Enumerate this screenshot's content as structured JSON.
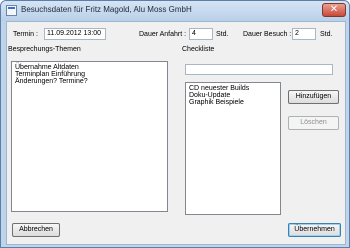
{
  "window": {
    "title": "Besuchsdaten für Fritz Magold, Alu Moss GmbH",
    "close_glyph": "✕"
  },
  "termin": {
    "label": "Termin :",
    "value": "11.09.2012 13:00"
  },
  "dauer_anfahrt": {
    "label": "Dauer Anfahrt :",
    "value": "4",
    "unit": "Std."
  },
  "dauer_besuch": {
    "label": "Dauer Besuch :",
    "value": "2",
    "unit": "Std."
  },
  "themen": {
    "label": "Besprechungs-Themen",
    "items": [
      "Übernahme Altdaten",
      "Terminplan Einführung",
      "Änderungen? Termine?"
    ]
  },
  "checkliste": {
    "label": "Checkliste",
    "input_value": "",
    "items": [
      "CD neuester Builds",
      "Doku-Update",
      "Graphik Beispiele"
    ],
    "add_label": "Hinzufügen",
    "delete_label": "Löschen"
  },
  "footer": {
    "cancel_label": "Abbrechen",
    "ok_label": "Übernehmen"
  }
}
